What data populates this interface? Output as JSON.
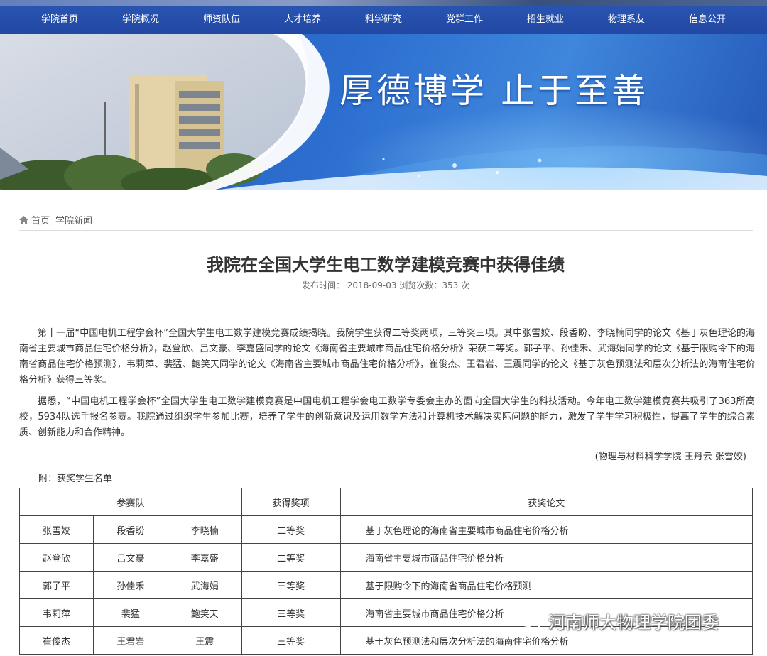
{
  "nav": {
    "items": [
      "学院首页",
      "学院概况",
      "师资队伍",
      "人才培养",
      "科学研究",
      "党群工作",
      "招生就业",
      "物理系友",
      "信息公开"
    ]
  },
  "banner": {
    "motto": "厚德博学  止于至善"
  },
  "breadcrumb": {
    "home": "首页",
    "current": "学院新闻"
  },
  "article": {
    "title": "我院在全国大学生电工数学建模竞赛中获得佳绩",
    "meta": "发布时间：  2018-09-03 浏览次数：353 次",
    "paragraphs": [
      "第十一届“中国电机工程学会杯”全国大学生电工数学建模竞赛成绩揭晓。我院学生获得二等奖两项，三等奖三项。其中张雪姣、段香盼、李晓楠同学的论文《基于灰色理论的海南省主要城市商品住宅价格分析》，赵登欣、吕文豪、李嘉盛同学的论文《海南省主要城市商品住宅价格分析》荣获二等奖。郭子平、孙佳禾、武海娟同学的论文《基于限购令下的海南省商品住宅价格预测》，韦莉萍、裴猛、鲍笑天同学的论文《海南省主要城市商品住宅价格分析》，崔俊杰、王君岩、王震同学的论文《基于灰色预测法和层次分析法的海南住宅价格分析》获得三等奖。",
      "据悉，“中国电机工程学会杯”全国大学生电工数学建模竞赛是中国电机工程学会电工数学专委会主办的面向全国大学生的科技活动。今年电工数学建模竞赛共吸引了363所高校，5934队选手报名参赛。我院通过组织学生参加比赛，培养了学生的创新意识及运用数学方法和计算机技术解决实际问题的能力，激发了学生学习积极性，提高了学生的综合素质、创新能力和合作精神。"
    ],
    "signature": "(物理与材料科学学院 王丹云 张雪姣)",
    "attachment_label": "附：获奖学生名单"
  },
  "table": {
    "headers": [
      "参赛队",
      "获得奖项",
      "获奖论文"
    ],
    "rows": [
      [
        "张雪姣",
        "段香盼",
        "李晓楠",
        "二等奖",
        "基于灰色理论的海南省主要城市商品住宅价格分析"
      ],
      [
        "赵登欣",
        "吕文豪",
        "李嘉盛",
        "二等奖",
        "海南省主要城市商品住宅价格分析"
      ],
      [
        "郭子平",
        "孙佳禾",
        "武海娟",
        "三等奖",
        "基于限购令下的海南省商品住宅价格预测"
      ],
      [
        "韦莉萍",
        "裴猛",
        "鲍笑天",
        "三等奖",
        "海南省主要城市商品住宅价格分析"
      ],
      [
        "崔俊杰",
        "王君岩",
        "王震",
        "三等奖",
        "基于灰色预测法和层次分析法的海南住宅价格分析"
      ]
    ]
  },
  "watermark": {
    "text": "河南师大物理学院团委",
    "icon": "wechat-icon"
  }
}
